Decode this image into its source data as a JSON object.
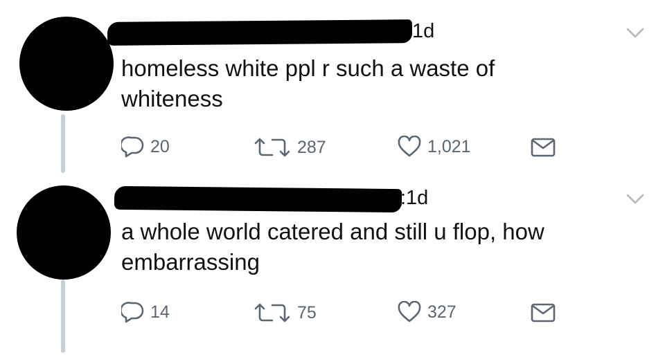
{
  "tweets": [
    {
      "time": "1d",
      "text": "homeless white ppl r such a waste of whiteness",
      "replies": "20",
      "retweets": "287",
      "likes": "1,021"
    },
    {
      "time": ":1d",
      "text": "a whole world catered and still u flop, how embarrassing",
      "replies": "14",
      "retweets": "75",
      "likes": "327"
    }
  ],
  "icons": {
    "reply": "reply-icon",
    "retweet": "retweet-icon",
    "like": "heart-icon",
    "dm": "envelope-icon",
    "menu": "chevron-down-icon"
  },
  "colors": {
    "thread_line": "#c8d1d8",
    "action_icon": "#5b6670",
    "redaction": "#000000"
  }
}
